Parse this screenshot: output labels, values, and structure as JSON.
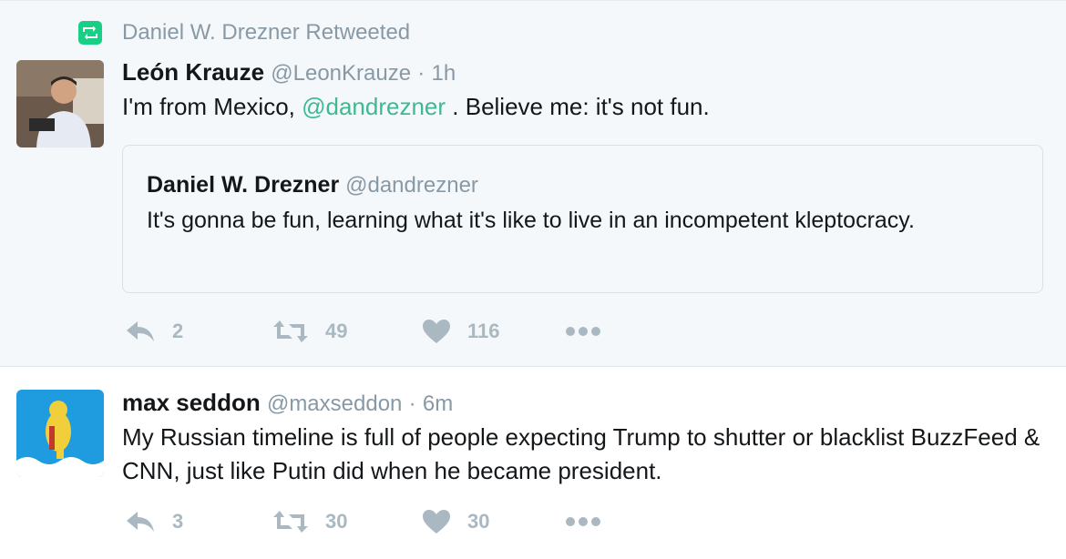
{
  "tweets": [
    {
      "retweeted_by": "Daniel W. Drezner Retweeted",
      "name": "León Krauze",
      "handle": "@LeonKrauze",
      "separator": "·",
      "time": "1h",
      "text_before": "I'm from Mexico,",
      "mention": "@dandrezner",
      "text_after": ". Believe me: it's not fun.",
      "quoted": {
        "name": "Daniel W. Drezner",
        "handle": "@dandrezner",
        "text": "It's gonna be fun, learning what it's like to live in an incompetent kleptocracy."
      },
      "actions": {
        "reply": "2",
        "retweet": "49",
        "like": "116"
      }
    },
    {
      "name": "max seddon",
      "handle": "@maxseddon",
      "separator": "·",
      "time": "6m",
      "text": "My Russian timeline is full of people expecting Trump to shutter or blacklist BuzzFeed & CNN, just like Putin did when he became president.",
      "actions": {
        "reply": "3",
        "retweet": "30",
        "like": "30"
      }
    }
  ],
  "icons": {
    "reply": "reply-icon",
    "retweet": "retweet-icon",
    "like": "heart-icon",
    "more": "more-dots-icon"
  },
  "colors": {
    "mention": "#3eb991",
    "retweet_badge": "#19cf86",
    "muted": "#8899a6",
    "action_icon": "#aab8c2"
  }
}
